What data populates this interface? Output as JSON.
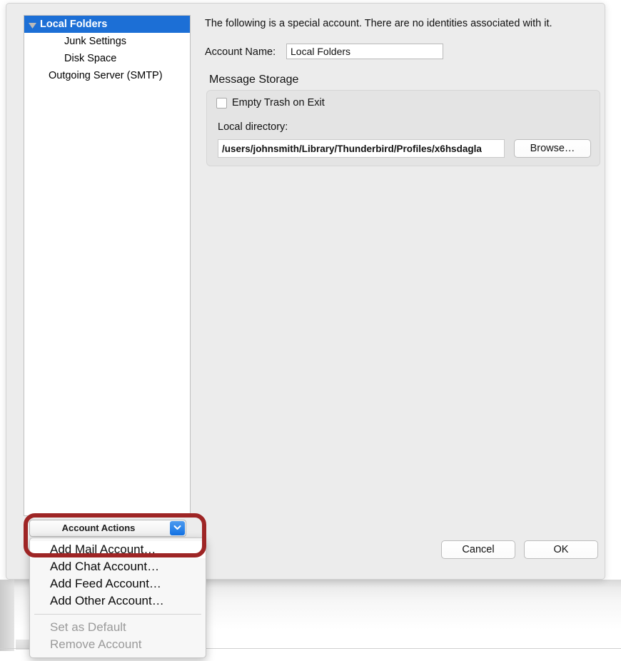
{
  "sidebar": {
    "items": [
      {
        "label": "Local Folders",
        "level": 0,
        "selected": true,
        "twisty": "disclosure-triangle-down-icon"
      },
      {
        "label": "Junk Settings",
        "level": 1,
        "selected": false,
        "twisty": null
      },
      {
        "label": "Disk Space",
        "level": 1,
        "selected": false,
        "twisty": null
      },
      {
        "label": "Outgoing Server (SMTP)",
        "level": 0,
        "selected": false,
        "twisty": null
      }
    ],
    "account_actions": {
      "label": "Account Actions",
      "chevron_icon": "chevron-down-icon",
      "menu_open": true,
      "menu_items": [
        {
          "label": "Add Mail Account…",
          "disabled": false,
          "highlighted": true
        },
        {
          "label": "Add Chat Account…",
          "disabled": false,
          "highlighted": false
        },
        {
          "label": "Add Feed Account…",
          "disabled": false,
          "highlighted": false
        },
        {
          "label": "Add Other Account…",
          "disabled": false,
          "highlighted": false
        },
        {
          "separator": true
        },
        {
          "label": "Set as Default",
          "disabled": true,
          "highlighted": false
        },
        {
          "label": "Remove Account",
          "disabled": true,
          "highlighted": false
        }
      ]
    }
  },
  "content": {
    "intro_text": "The following is a special account. There are no identities associated with it.",
    "account_name_label": "Account Name:",
    "account_name_value": "Local Folders",
    "account_name_placeholder": "Account Name",
    "message_storage": {
      "title": "Message Storage",
      "empty_trash_label": "Empty Trash on Exit",
      "empty_trash_checked": false,
      "local_directory_label": "Local directory:",
      "local_directory_value": "/users/johnsmith/Library/Thunderbird/Profiles/x6hsdagla",
      "local_directory_placeholder": "Local directory",
      "browse_label": "Browse…"
    }
  },
  "footer": {
    "cancel_label": "Cancel",
    "ok_label": "OK"
  },
  "annotation": {
    "color": "#9e2525",
    "shape": "rounded-rectangle-outline"
  },
  "colors": {
    "selection_blue": "#1c6fd6",
    "chevron_blue": "#1473e6",
    "dialog_background": "#ececec",
    "group_background": "#e4e4e4",
    "disabled_text": "#9a9a9a"
  }
}
